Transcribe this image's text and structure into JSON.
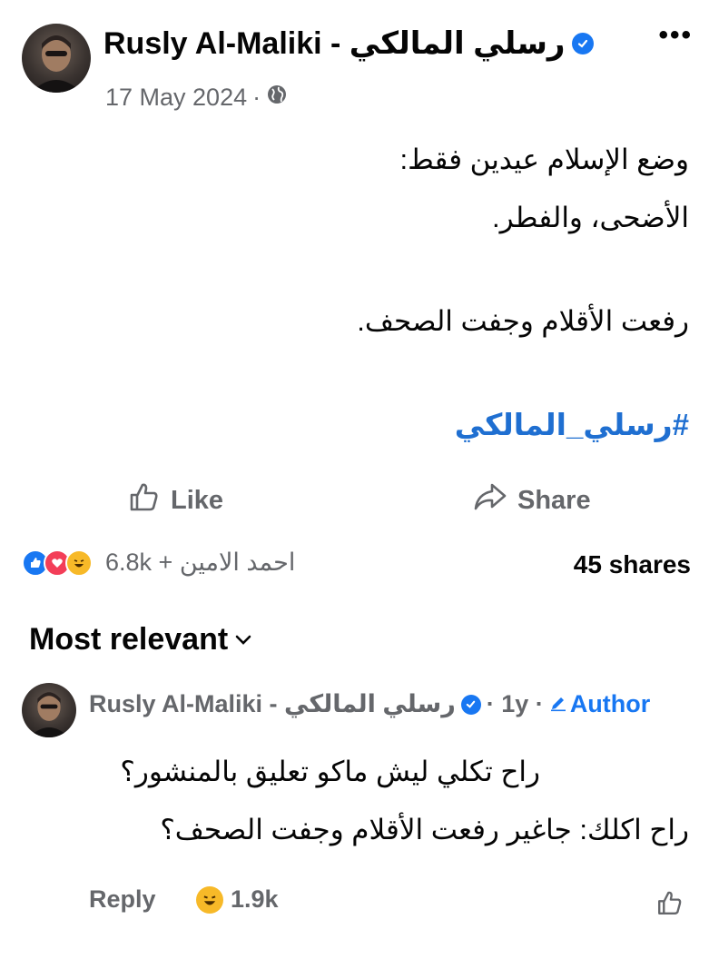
{
  "post": {
    "author": "Rusly Al-Maliki - رسلي المالكي",
    "date": "17 May 2024",
    "separator": "·",
    "more_icon": "more-horizontal-icon",
    "lines": [
      "وضع الإسلام عيدين فقط:",
      "الأضحى، والفطر.",
      "رفعت الأقلام وجفت الصحف."
    ],
    "hashtag": "#رسلي_المالكي"
  },
  "actions": {
    "like_label": "Like",
    "share_label": "Share"
  },
  "stats": {
    "reactions_text": "6.8k + احمد الامين",
    "shares_text": "45 shares",
    "reaction_icons": [
      "like-icon",
      "love-icon",
      "haha-icon"
    ]
  },
  "comments": {
    "sort_label": "Most relevant",
    "items": [
      {
        "author": "Rusly Al-Maliki - رسلي المالكي",
        "time": "· 1y ·",
        "badge": "Author",
        "lines": [
          "راح تكلي ليش ماكو تعليق بالمنشور؟",
          "راح اكلك: جاغير رفعت الأقلام وجفت الصحف؟"
        ],
        "reply_label": "Reply",
        "reaction_count": "1.9k"
      }
    ]
  },
  "colors": {
    "accent": "#1877f2",
    "hashtag": "#1f6fd1",
    "secondary_text": "#65676b",
    "haha": "#f7b928",
    "love": "#f33e58"
  }
}
